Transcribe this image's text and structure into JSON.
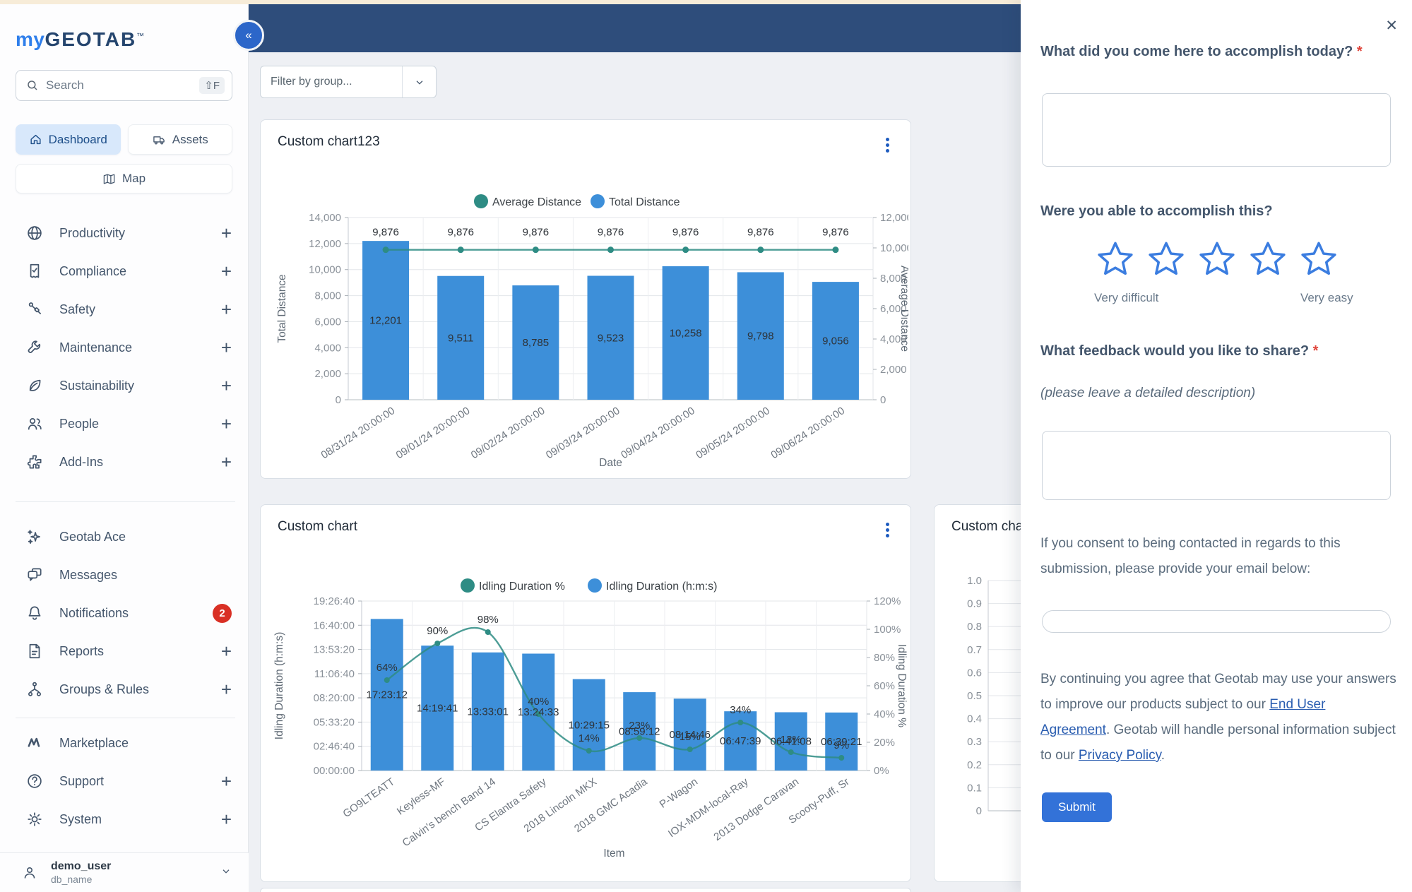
{
  "sidebar": {
    "logo": {
      "my": "my",
      "geotab": "GEOTAB",
      "tm": "™"
    },
    "search": {
      "placeholder": "Search",
      "shortcut": "⇧F"
    },
    "quick_buttons": [
      {
        "label": "Dashboard",
        "icon": "home",
        "active": true
      },
      {
        "label": "Assets",
        "icon": "truck",
        "active": false
      }
    ],
    "map_button": {
      "label": "Map",
      "icon": "map"
    },
    "nav_primary": [
      {
        "label": "Productivity",
        "icon": "globe",
        "expandable": true
      },
      {
        "label": "Compliance",
        "icon": "compliance",
        "expandable": true
      },
      {
        "label": "Safety",
        "icon": "seatbelt",
        "expandable": true
      },
      {
        "label": "Maintenance",
        "icon": "wrench",
        "expandable": true
      },
      {
        "label": "Sustainability",
        "icon": "leaf",
        "expandable": true
      },
      {
        "label": "People",
        "icon": "people",
        "expandable": true
      },
      {
        "label": "Add-Ins",
        "icon": "puzzle",
        "expandable": true
      }
    ],
    "nav_secondary": [
      {
        "label": "Geotab Ace",
        "icon": "sparkles",
        "expandable": false
      },
      {
        "label": "Messages",
        "icon": "chat",
        "expandable": false
      },
      {
        "label": "Notifications",
        "icon": "bell",
        "expandable": false,
        "badge": "2"
      },
      {
        "label": "Reports",
        "icon": "document",
        "expandable": true
      },
      {
        "label": "Groups & Rules",
        "icon": "hierarchy",
        "expandable": true
      }
    ],
    "nav_tertiary": [
      {
        "label": "Marketplace",
        "icon": "marketplace",
        "expandable": false
      },
      {
        "label": "Support",
        "icon": "help",
        "expandable": true
      },
      {
        "label": "System",
        "icon": "gear",
        "expandable": true
      }
    ],
    "user": {
      "name": "demo_user",
      "database": "db_name"
    }
  },
  "header": {
    "collapse_icon": "«"
  },
  "toolbar": {
    "filter_placeholder": "Filter by group..."
  },
  "cards": [
    {
      "title": "Custom chart123"
    },
    {
      "title": "Custom chart"
    },
    {
      "title": "Custom char"
    }
  ],
  "chart_data": [
    {
      "type": "bar",
      "title": "Custom chart123",
      "categories": [
        "08/31/24 20:00:00",
        "09/01/24 20:00:00",
        "09/02/24 20:00:00",
        "09/03/24 20:00:00",
        "09/04/24 20:00:00",
        "09/05/24 20:00:00",
        "09/06/24 20:00:00"
      ],
      "series": [
        {
          "name": "Total Distance",
          "type": "bar",
          "axis": "left",
          "color": "#3d8fd9",
          "values": [
            12201,
            9511,
            8785,
            9523,
            10258,
            9798,
            9056
          ]
        },
        {
          "name": "Average Distance",
          "type": "line",
          "axis": "right",
          "color": "#2e8c84",
          "values": [
            9876,
            9876,
            9876,
            9876,
            9876,
            9876,
            9876
          ]
        }
      ],
      "left_axis": {
        "label": "Total Distance",
        "min": 0,
        "max": 14000,
        "step": 2000
      },
      "right_axis": {
        "label": "Average Distance",
        "min": 0,
        "max": 12000,
        "step": 2000
      },
      "xlabel": "Date",
      "legend_position": "top",
      "grid": true
    },
    {
      "type": "bar",
      "title": "Custom chart",
      "categories": [
        "GO9LTEATT",
        "Keyless-MF",
        "Calvin's bench Band 14",
        "CS Elantra Safety",
        "2018 Lincoln MKX",
        "2018 GMC Acadia",
        "P-Wagon",
        "IOX-MDM-local-Ray",
        "2013 Dodge Caravan",
        "Scooty-Puff, Sr"
      ],
      "series": [
        {
          "name": "Idling Duration (h:m:s)",
          "type": "bar",
          "axis": "left",
          "color": "#3d8fd9",
          "values_hms": [
            "17:23:12",
            "14:19:41",
            "13:33:01",
            "13:24:33",
            "10:29:15",
            "08:59:12",
            "08:14:46",
            "06:47:39",
            "06:41:08",
            "06:39:21"
          ]
        },
        {
          "name": "Idling Duration %",
          "type": "line",
          "axis": "right",
          "color": "#2e8c84",
          "values": [
            64,
            90,
            98,
            40,
            14,
            23,
            15,
            34,
            13,
            9
          ]
        }
      ],
      "left_axis": {
        "label": "Idling Duration (h:m:s)",
        "min": 0,
        "max": 70000,
        "step": 10000,
        "format": "hms"
      },
      "right_axis": {
        "label": "Idling Duration %",
        "min": 0,
        "max": 120,
        "step": 20,
        "suffix": "%"
      },
      "xlabel": "Item",
      "legend_position": "top",
      "grid": true
    },
    {
      "type": "bar",
      "title": "Custom char",
      "note": "partially hidden behind feedback panel",
      "categories": [],
      "series": [],
      "left_axis": {
        "min": 0,
        "max": 1.0,
        "step": 0.1
      },
      "grid": true
    }
  ],
  "feedback_panel": {
    "close_icon": "✕",
    "q1": {
      "label": "What did you come here to accomplish today?",
      "required": "*",
      "value": ""
    },
    "q2": {
      "label": "Were you able to accomplish this?",
      "stars": 5,
      "low_caption": "Very difficult",
      "high_caption": "Very easy",
      "selected": 0
    },
    "q3": {
      "label": "What feedback would you like to share?",
      "required": "*",
      "hint": "(please leave a detailed description)",
      "value": ""
    },
    "email": {
      "label": "If you consent to being contacted in regards to this submission, please provide your email below:",
      "value": ""
    },
    "legal": {
      "part1": "By continuing you agree that Geotab may use your answers to improve our products subject to our ",
      "link1": "End User Agreement",
      "part2": ". Geotab will handle personal information subject to our ",
      "link2": "Privacy Policy",
      "part3": "."
    },
    "submit_label": "Submit"
  }
}
